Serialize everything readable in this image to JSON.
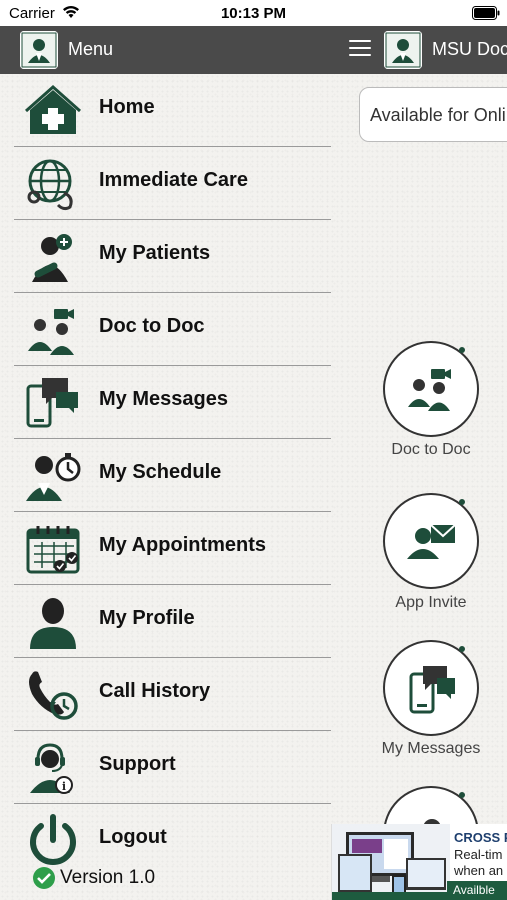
{
  "status_bar": {
    "carrier": "Carrier",
    "time": "10:13 PM"
  },
  "navbar": {
    "menu_title": "Menu",
    "app_title": "MSU Doc",
    "logo_label": "Doctor"
  },
  "menu": {
    "items": [
      {
        "label": "Home",
        "icon": "home-icon"
      },
      {
        "label": "Immediate Care",
        "icon": "globe-stethoscope-icon"
      },
      {
        "label": "My Patients",
        "icon": "patient-add-icon"
      },
      {
        "label": "Doc to Doc",
        "icon": "doctors-video-icon"
      },
      {
        "label": "My Messages",
        "icon": "phone-messages-icon"
      },
      {
        "label": "My Schedule",
        "icon": "doctor-clock-icon"
      },
      {
        "label": "My Appointments",
        "icon": "calendar-check-icon"
      },
      {
        "label": "My Profile",
        "icon": "user-profile-icon"
      },
      {
        "label": "Call History",
        "icon": "phone-history-icon"
      },
      {
        "label": "Support",
        "icon": "headset-support-icon"
      },
      {
        "label": "Logout",
        "icon": "power-icon"
      }
    ],
    "version": "Version  1.0"
  },
  "main": {
    "availability": "Available for Online",
    "circles": [
      {
        "label": "Doc to Doc",
        "icon": "doctors-video-icon"
      },
      {
        "label": "App Invite",
        "icon": "user-invite-icon"
      },
      {
        "label": "My Messages",
        "icon": "phone-messages-icon"
      }
    ]
  },
  "ad": {
    "title": "CROSS P",
    "line1": "Real-tim",
    "line2": "when an",
    "footer": "Availble"
  },
  "colors": {
    "brand_green": "#1e4d3a",
    "navbar": "#4a4a4a"
  }
}
